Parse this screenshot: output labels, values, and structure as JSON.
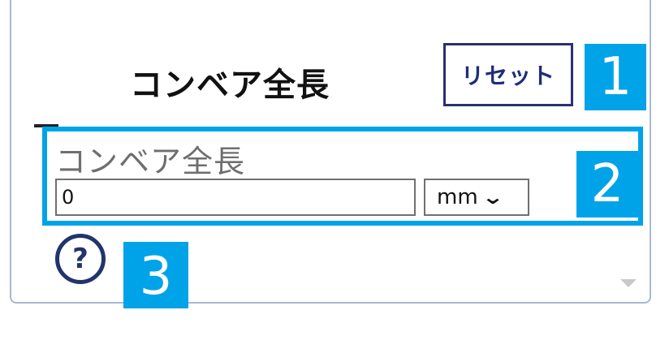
{
  "panel": {
    "title": "コンベア全長",
    "reset_label": "リセット"
  },
  "field": {
    "label": "コンベア全長",
    "value": "0",
    "unit_selected": "mm"
  },
  "badges": {
    "one": "1",
    "two": "2",
    "three": "3"
  },
  "icons": {
    "help": "?",
    "unit_dropdown": "chevron-down-icon",
    "scroll_down": "chevron-down-icon"
  },
  "colors": {
    "badge": "#00a3e8",
    "reset_border": "#2b2f73",
    "panel_border": "#a9b7d3",
    "help": "#22346b"
  }
}
